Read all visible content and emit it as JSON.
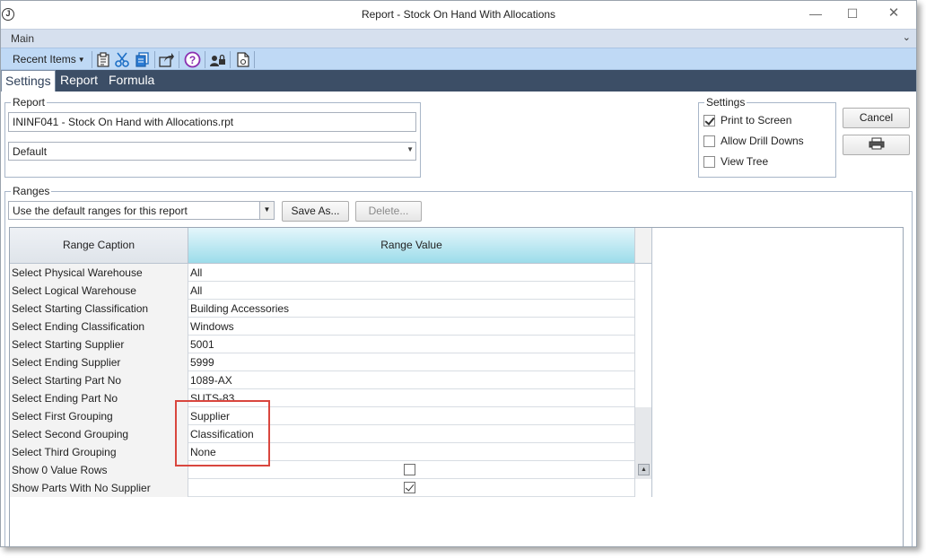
{
  "window": {
    "title": "Report - Stock On Hand With Allocations",
    "app_icon_letter": "J",
    "minimize": "—",
    "maximize": "☐",
    "close": "✕"
  },
  "ribbon": {
    "tab_label": "Main",
    "chevron": "⌄"
  },
  "toolbar": {
    "recent_items_label": "Recent Items",
    "icons": [
      "clipboard-icon",
      "scissors-icon",
      "copy-icon",
      "share-icon",
      "help-icon",
      "user-lock-icon",
      "document-icon"
    ]
  },
  "tabs": [
    {
      "label": "Settings",
      "active": true
    },
    {
      "label": "Report",
      "active": false
    },
    {
      "label": "Formula",
      "active": false
    }
  ],
  "report_group": {
    "label": "Report",
    "report_file": "ININF041 - Stock On Hand with Allocations.rpt",
    "format_selected": "Default"
  },
  "settings_group": {
    "label": "Settings",
    "options": [
      {
        "label": "Print to Screen",
        "checked": true
      },
      {
        "label": "Allow Drill Downs",
        "checked": false
      },
      {
        "label": "View Tree",
        "checked": false
      }
    ]
  },
  "buttons": {
    "cancel": "Cancel",
    "save_as": "Save As...",
    "delete": "Delete..."
  },
  "ranges_group": {
    "label": "Ranges",
    "preset_selected": "Use the default ranges for this report"
  },
  "grid": {
    "columns": [
      "Range Caption",
      "Range Value"
    ],
    "rows": [
      {
        "caption": "Select Physical Warehouse",
        "value": "All"
      },
      {
        "caption": "Select Logical Warehouse",
        "value": "All"
      },
      {
        "caption": "Select Starting Classification",
        "value": "Building Accessories"
      },
      {
        "caption": "Select Ending Classification",
        "value": "Windows"
      },
      {
        "caption": "Select Starting Supplier",
        "value": "5001"
      },
      {
        "caption": "Select Ending Supplier",
        "value": "5999"
      },
      {
        "caption": "Select Starting Part No",
        "value": "1089-AX"
      },
      {
        "caption": "Select Ending Part No",
        "value": "SUTS-83"
      },
      {
        "caption": "Select First Grouping",
        "value": "Supplier"
      },
      {
        "caption": "Select Second Grouping",
        "value": "Classification"
      },
      {
        "caption": "Select Third Grouping",
        "value": "None"
      },
      {
        "caption": "Show 0 Value Rows",
        "checked": false
      },
      {
        "caption": "Show Parts With No Supplier",
        "checked": true
      }
    ]
  },
  "colors": {
    "tabbar": "#3c4e66",
    "toolbar": "#bfd9f5",
    "highlight": "#d9463e",
    "value_header": "#9cdcea"
  }
}
